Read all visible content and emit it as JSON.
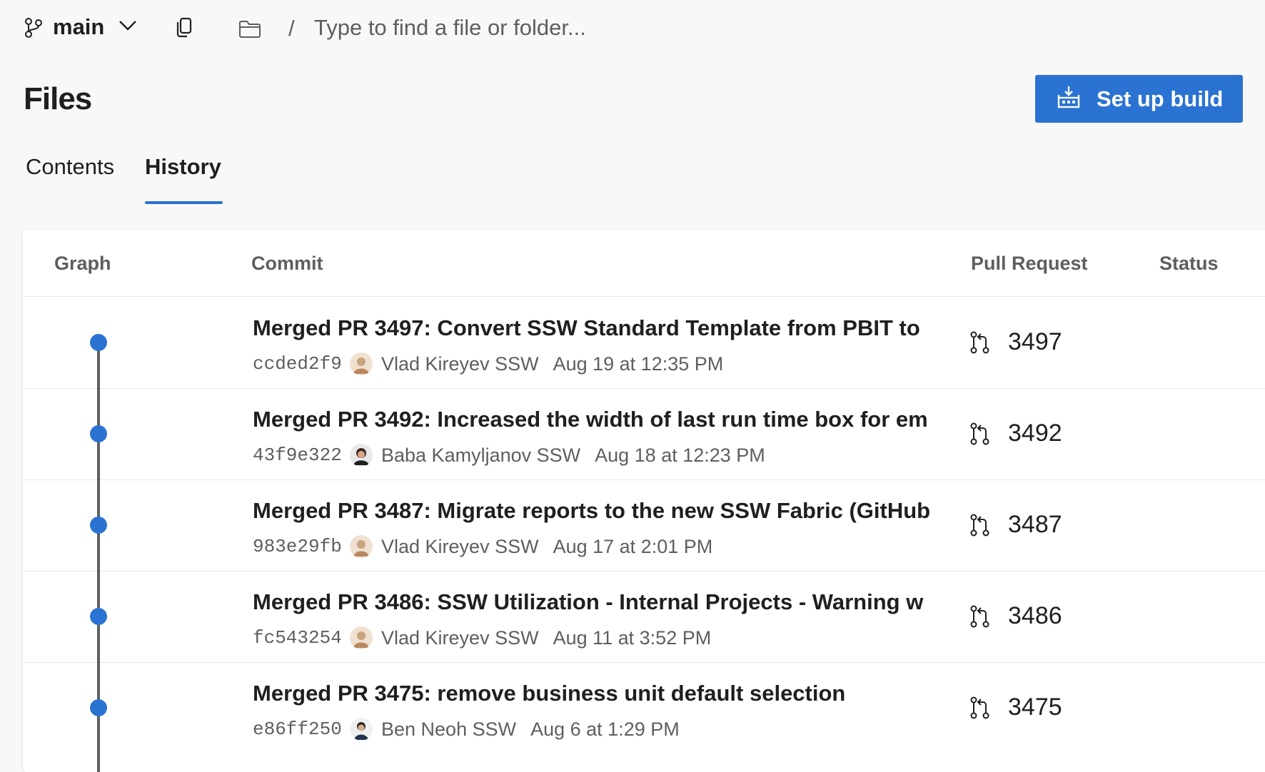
{
  "toolbar": {
    "branch": "main",
    "path_separator": "/",
    "search_placeholder": "Type to find a file or folder..."
  },
  "page": {
    "title": "Files",
    "action_button": "Set up build"
  },
  "tabs": [
    {
      "label": "Contents",
      "active": false
    },
    {
      "label": "History",
      "active": true
    }
  ],
  "table": {
    "columns": [
      "Graph",
      "Commit",
      "Pull Request",
      "Status"
    ],
    "rows": [
      {
        "title": "Merged PR 3497: Convert SSW Standard Template from PBIT to",
        "hash": "ccded2f9",
        "author": "Vlad Kireyev SSW",
        "date": "Aug 19 at 12:35 PM",
        "pr": "3497",
        "status": ""
      },
      {
        "title": "Merged PR 3492: Increased the width of last run time box for em",
        "hash": "43f9e322",
        "author": "Baba Kamyljanov SSW",
        "date": "Aug 18 at 12:23 PM",
        "pr": "3492",
        "status": ""
      },
      {
        "title": "Merged PR 3487: Migrate reports to the new SSW Fabric (GitHub",
        "hash": "983e29fb",
        "author": "Vlad Kireyev SSW",
        "date": "Aug 17 at 2:01 PM",
        "pr": "3487",
        "status": ""
      },
      {
        "title": "Merged PR 3486: SSW Utilization - Internal Projects - Warning w",
        "hash": "fc543254",
        "author": "Vlad Kireyev SSW",
        "date": "Aug 11 at 3:52 PM",
        "pr": "3486",
        "status": ""
      },
      {
        "title": "Merged PR 3475: remove business unit default selection",
        "hash": "e86ff250",
        "author": "Ben Neoh SSW",
        "date": "Aug 6 at 1:29 PM",
        "pr": "3475",
        "status": ""
      }
    ]
  },
  "colors": {
    "accent": "#2b73d2",
    "background": "#f8f8f8",
    "graph_line": "#5f5f5f"
  },
  "icons": {
    "branch": "branch-icon",
    "chevron": "chevron-down-icon",
    "copy": "copy-icon",
    "folder": "folder-icon",
    "build": "build-pipeline-icon",
    "pull_request": "pull-request-icon"
  }
}
